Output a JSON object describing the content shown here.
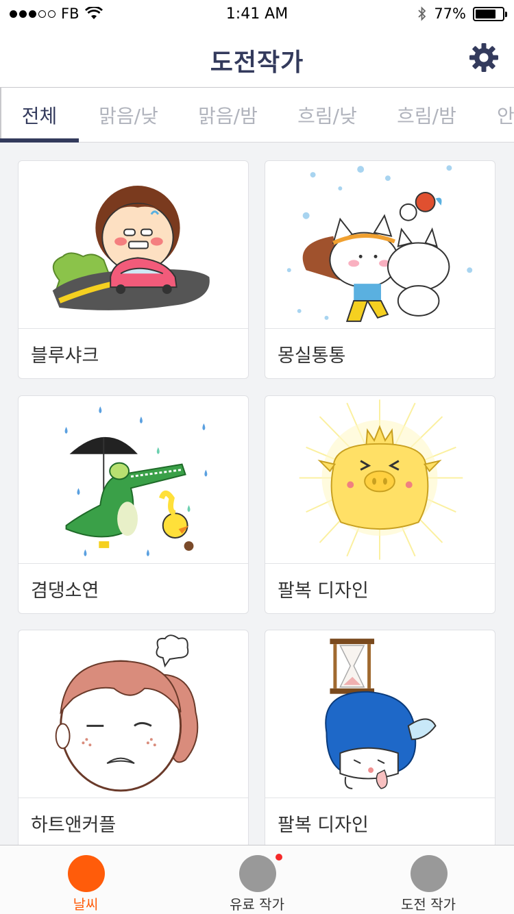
{
  "status_bar": {
    "carrier": "FB",
    "time": "1:41 AM",
    "battery_percent": "77%",
    "battery_level": 0.77,
    "signal_icon": "signal-dots-icon",
    "wifi_icon": "wifi-icon",
    "bluetooth_icon": "bluetooth-icon"
  },
  "header": {
    "title": "도전작가",
    "settings_icon": "gear-icon"
  },
  "tabs": [
    {
      "label": "전체",
      "active": true
    },
    {
      "label": "맑음/낮",
      "active": false
    },
    {
      "label": "맑음/밤",
      "active": false
    },
    {
      "label": "흐림/낮",
      "active": false
    },
    {
      "label": "흐림/밤",
      "active": false
    },
    {
      "label": "안",
      "active": false
    }
  ],
  "cards": [
    {
      "label": "블루샤크",
      "image": "girl-in-pink-car"
    },
    {
      "label": "몽실통통",
      "image": "white-cats-in-snow"
    },
    {
      "label": "겸댕소연",
      "image": "crocodile-with-umbrella"
    },
    {
      "label": "팔복 디자인",
      "image": "glowing-yellow-pig"
    },
    {
      "label": "하트앤커플",
      "image": "frowning-girl-pink-hair"
    },
    {
      "label": "팔복 디자인",
      "image": "girl-with-hourglass"
    }
  ],
  "bottom_tabs": [
    {
      "label": "날씨",
      "active": true,
      "badge": false
    },
    {
      "label": "유료 작가",
      "active": false,
      "badge": true
    },
    {
      "label": "도전 작가",
      "active": false,
      "badge": false
    }
  ],
  "colors": {
    "accent": "#ff5c0a",
    "title": "#333a5c",
    "inactive_tab": "#b0b3bc",
    "badge": "#f52a2a"
  }
}
